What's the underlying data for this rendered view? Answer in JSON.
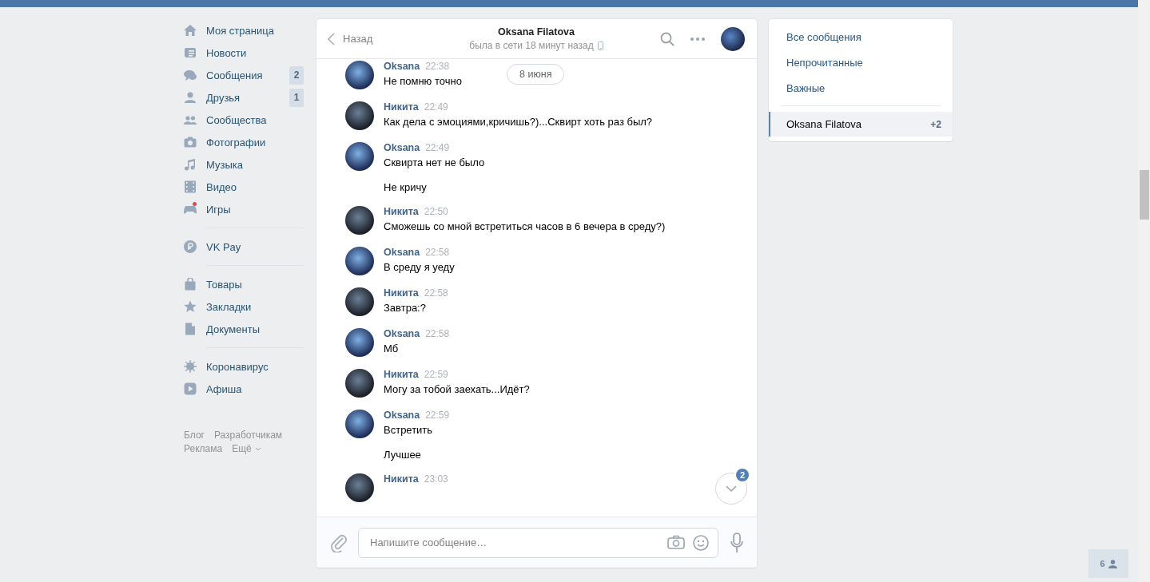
{
  "nav": {
    "groups": [
      {
        "items": [
          {
            "label": "Моя страница"
          },
          {
            "label": "Новости"
          },
          {
            "label": "Сообщения",
            "count": "2"
          },
          {
            "label": "Друзья",
            "count": "1"
          },
          {
            "label": "Сообщества"
          },
          {
            "label": "Фотографии"
          },
          {
            "label": "Музыка"
          },
          {
            "label": "Видео"
          },
          {
            "label": "Игры",
            "dot": true
          }
        ]
      },
      {
        "items": [
          {
            "label": "VK Pay"
          }
        ]
      },
      {
        "items": [
          {
            "label": "Товары"
          },
          {
            "label": "Закладки"
          },
          {
            "label": "Документы"
          }
        ]
      },
      {
        "items": [
          {
            "label": "Коронавирус"
          },
          {
            "label": "Афиша"
          }
        ]
      }
    ],
    "footer": [
      [
        "Блог",
        "Разработчикам"
      ],
      [
        "Реклама",
        "Ещё"
      ]
    ]
  },
  "chat": {
    "back": "Назад",
    "title": "Oksana Filatova",
    "status": "была в сети 18 минут назад",
    "date_pill": "8 июня",
    "messages": [
      {
        "author": "Oksana",
        "time": "22:38",
        "texts": [
          "Не помню точно"
        ]
      },
      {
        "author": "Никита",
        "time": "22:49",
        "texts": [
          "Как дела с эмоциями,кричишь?)...Сквирт хоть раз был?"
        ]
      },
      {
        "author": "Oksana",
        "time": "22:49",
        "texts": [
          "Сквирта нет не было",
          "Не кричу"
        ]
      },
      {
        "author": "Никита",
        "time": "22:50",
        "texts": [
          "Сможешь со мной встретиться часов в 6 вечера в среду?)"
        ]
      },
      {
        "author": "Oksana",
        "time": "22:58",
        "texts": [
          "В среду я уеду"
        ]
      },
      {
        "author": "Никита",
        "time": "22:58",
        "texts": [
          "Завтра:?"
        ]
      },
      {
        "author": "Oksana",
        "time": "22:58",
        "texts": [
          "Мб"
        ]
      },
      {
        "author": "Никита",
        "time": "22:59",
        "texts": [
          "Могу за тобой заехать...Идёт?"
        ]
      },
      {
        "author": "Oksana",
        "time": "22:59",
        "texts": [
          "Встретить",
          "Лучшее"
        ]
      },
      {
        "author": "Никита",
        "time": "23:03"
      }
    ],
    "unread_badge": "2",
    "input": {
      "placeholder": "Напишите сообщение…"
    }
  },
  "filters": [
    {
      "label": "Все сообщения",
      "selected": false
    },
    {
      "label": "Непрочитанные",
      "selected": false
    },
    {
      "label": "Важные",
      "selected": false
    },
    {
      "label": "Oksana Filatova",
      "count": "+2",
      "selected": true
    }
  ],
  "online_friends": "6"
}
